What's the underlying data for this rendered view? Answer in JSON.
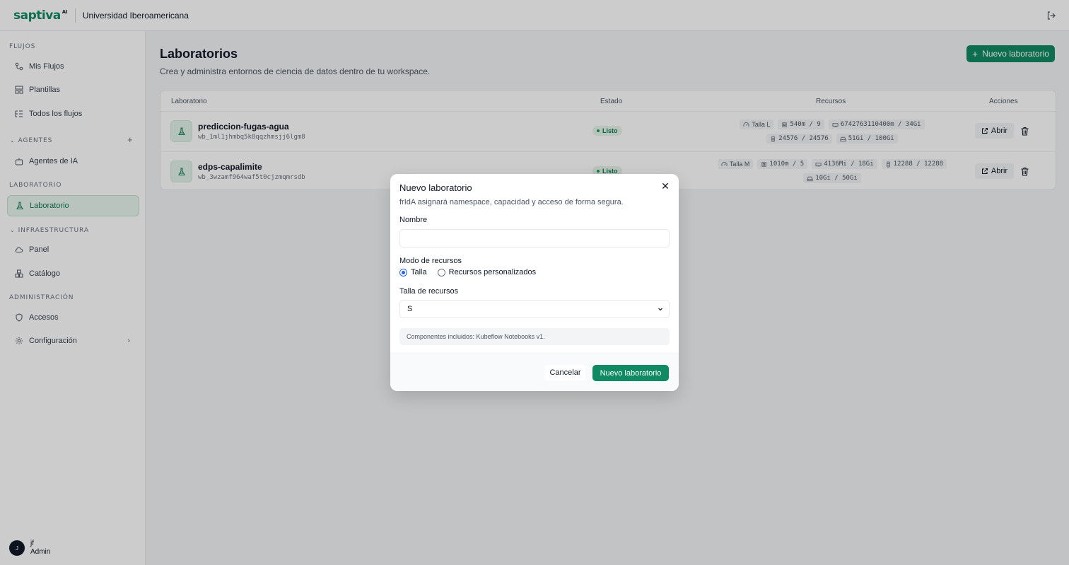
{
  "brand": {
    "logo": "saptiva",
    "logo_sup": "AI",
    "org": "Universidad Iberoamericana"
  },
  "sidebar": {
    "sections": {
      "flujos": "FLUJOS",
      "agentes": "AGENTES",
      "laboratorio": "LABORATORIO",
      "infraestructura": "INFRAESTRUCTURA",
      "administracion": "ADMINISTRACIÓN"
    },
    "items": {
      "mis_flujos": "Mis Flujos",
      "plantillas": "Plantillas",
      "todos_flujos": "Todos los flujos",
      "agentes_ia": "Agentes de IA",
      "laboratorio": "Laboratorio",
      "panel": "Panel",
      "catalogo": "Catálogo",
      "accesos": "Accesos",
      "configuracion": "Configuración"
    },
    "add_symbol": "+",
    "user": {
      "initial": "J",
      "name": "jf",
      "role": "Admin"
    }
  },
  "main": {
    "title": "Laboratorios",
    "subtitle": "Crea y administra entornos de ciencia de datos dentro de tu workspace.",
    "new_button": "Nuevo laboratorio",
    "columns": {
      "lab": "Laboratorio",
      "estado": "Estado",
      "recursos": "Recursos",
      "acciones": "Acciones"
    },
    "rows": [
      {
        "name": "prediccion-fugas-agua",
        "id": "wb_1ml1jhmbq5k8qqzhmsjj6lgm8",
        "status": "Listo",
        "size": "Talla L",
        "cpu": "540m / 9",
        "mem": "6742763110400m / 34Gi",
        "gpu": "24576 / 24576",
        "disk": "51Gi / 100Gi",
        "open": "Abrir"
      },
      {
        "name": "edps-capalimite",
        "id": "wb_3wzamf964waf5t0cjzmqmrsdb",
        "status": "Listo",
        "size": "Talla M",
        "cpu": "1010m / 5",
        "mem": "4136Mi / 18Gi",
        "gpu": "12288 / 12288",
        "disk": "10Gi / 50Gi",
        "open": "Abrir"
      }
    ]
  },
  "modal": {
    "title": "Nuevo laboratorio",
    "subtitle": "frIdA asignará namespace, capacidad y acceso de forma segura.",
    "name_label": "Nombre",
    "name_value": "",
    "mode_label": "Modo de recursos",
    "mode_options": [
      "Talla",
      "Recursos personalizados"
    ],
    "mode_selected": "Talla",
    "size_label": "Talla de recursos",
    "size_value": "S",
    "info": "Componentes incluidos: Kubeflow Notebooks v1.",
    "cancel": "Cancelar",
    "submit": "Nuevo laboratorio",
    "close_symbol": "✕"
  },
  "colors": {
    "accent": "#0f8a62",
    "status_bg": "#e6f4ec",
    "radio": "#2563eb"
  }
}
